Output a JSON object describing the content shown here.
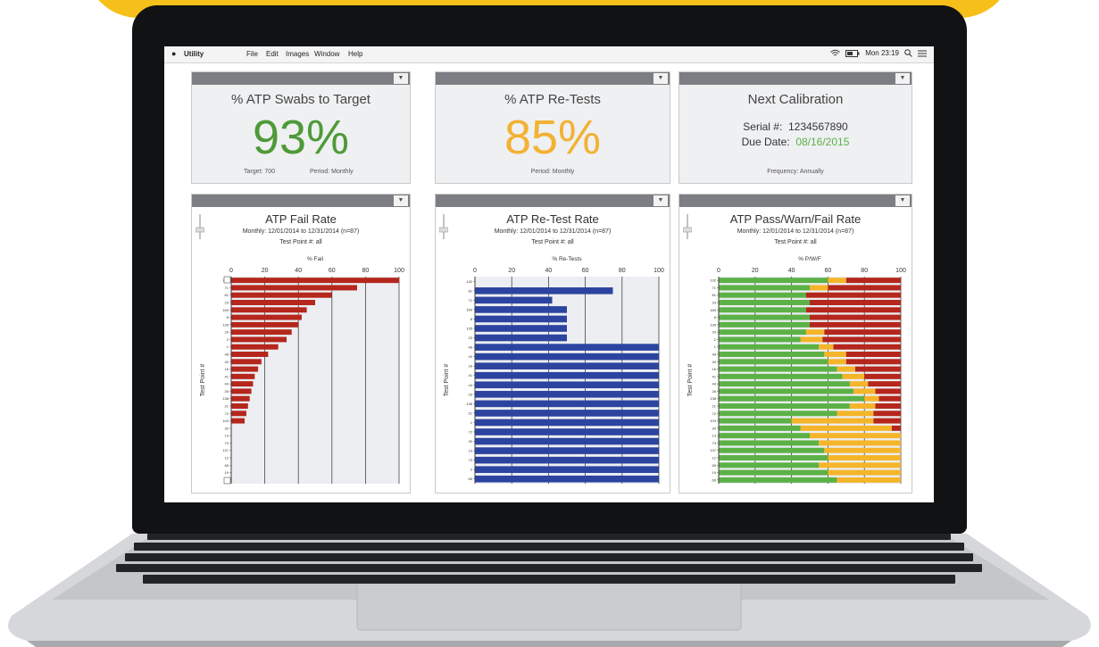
{
  "menubar": {
    "app": "Utility",
    "menus": [
      "File",
      "Edit",
      "Images",
      "Window",
      "Help"
    ],
    "clock": "Mon 23:19"
  },
  "kpi": {
    "swabs": {
      "title": "% ATP Swabs to Target",
      "value": "93%",
      "target": "Target: 700",
      "period": "Period: Monthly",
      "color": "#4e9a38"
    },
    "retests": {
      "title": "% ATP Re-Tests",
      "value": "85%",
      "period": "Period: Monthly",
      "color": "#f2b233"
    },
    "calibration": {
      "title": "Next Calibration",
      "serial_label": "Serial #:",
      "serial": "1234567890",
      "due_label": "Due Date:",
      "due": "08/16/2015",
      "frequency": "Frequency: Annually",
      "due_color": "#5bb04a"
    }
  },
  "chart_data": [
    {
      "type": "bar",
      "title": "ATP Fail Rate",
      "subtitle": "Monthly:  12/01/2014 to 12/31/2014 (n=87)",
      "test_point": "Test Point #: all",
      "xlabel": "% Fail",
      "ylabel": "Test Point #",
      "xlim": [
        0,
        100
      ],
      "ticks": [
        0,
        20,
        40,
        60,
        80,
        100
      ],
      "color": "#b5261c",
      "categories": [
        "132",
        "71",
        "81",
        "23",
        "169",
        "8",
        "135",
        "29",
        "2",
        "1",
        "48",
        "40",
        "16",
        "41",
        "44",
        "26",
        "138",
        "21",
        "72",
        "103",
        "30",
        "13",
        "73",
        "137",
        "12",
        "65",
        "19",
        "66"
      ],
      "values": [
        100,
        75,
        60,
        50,
        45,
        42,
        40,
        36,
        33,
        28,
        22,
        18,
        16,
        14,
        13,
        12,
        11,
        10,
        9,
        8,
        0,
        0,
        0,
        0,
        0,
        0,
        0,
        0
      ]
    },
    {
      "type": "bar",
      "title": "ATP Re-Test Rate",
      "subtitle": "Monthly:  12/01/2014 to 12/31/2014 (n=87)",
      "test_point": "Test Point #: all",
      "xlabel": "% Re-Tests",
      "ylabel": "Test Point #",
      "xlim": [
        0,
        100
      ],
      "ticks": [
        0,
        20,
        40,
        60,
        80,
        100
      ],
      "color": "#2c44a0",
      "categories": [
        "132",
        "81",
        "71",
        "169",
        "8",
        "135",
        "23",
        "48",
        "40",
        "16",
        "41",
        "44",
        "29",
        "138",
        "21",
        "1",
        "72",
        "30",
        "13",
        "73",
        "2",
        "65"
      ],
      "values": [
        0,
        75,
        42,
        50,
        50,
        50,
        50,
        100,
        100,
        100,
        100,
        100,
        100,
        100,
        100,
        100,
        100,
        100,
        100,
        100,
        100,
        100
      ]
    },
    {
      "type": "bar",
      "title": "ATP Pass/Warn/Fail Rate",
      "subtitle": "Monthly:  12/01/2014 to 12/31/2014 (n=87)",
      "test_point": "Test Point #: all",
      "xlabel": "% P/W/F",
      "ylabel": "Test Point #",
      "xlim": [
        0,
        100
      ],
      "ticks": [
        0,
        20,
        40,
        60,
        80,
        100
      ],
      "colors": {
        "pass": "#5cb146",
        "warn": "#f5b52a",
        "fail": "#b5261c"
      },
      "categories": [
        "132",
        "71",
        "81",
        "23",
        "169",
        "8",
        "135",
        "29",
        "2",
        "1",
        "48",
        "40",
        "16",
        "41",
        "44",
        "26",
        "138",
        "21",
        "72",
        "103",
        "30",
        "13",
        "73",
        "137",
        "12",
        "65",
        "19",
        "66"
      ],
      "series": [
        {
          "name": "pass",
          "values": [
            60,
            50,
            48,
            50,
            48,
            50,
            50,
            48,
            45,
            55,
            58,
            60,
            65,
            68,
            72,
            74,
            80,
            72,
            65,
            40,
            45,
            50,
            55,
            58,
            60,
            55,
            60,
            65
          ]
        },
        {
          "name": "warn",
          "values": [
            10,
            10,
            0,
            0,
            0,
            0,
            0,
            10,
            12,
            8,
            12,
            10,
            10,
            12,
            10,
            12,
            8,
            14,
            20,
            45,
            50,
            50,
            45,
            42,
            40,
            45,
            40,
            35
          ]
        },
        {
          "name": "fail",
          "values": [
            30,
            40,
            52,
            50,
            52,
            50,
            50,
            42,
            43,
            37,
            30,
            30,
            25,
            20,
            18,
            14,
            12,
            14,
            15,
            15,
            5,
            0,
            0,
            0,
            0,
            0,
            0,
            0
          ]
        }
      ]
    }
  ]
}
